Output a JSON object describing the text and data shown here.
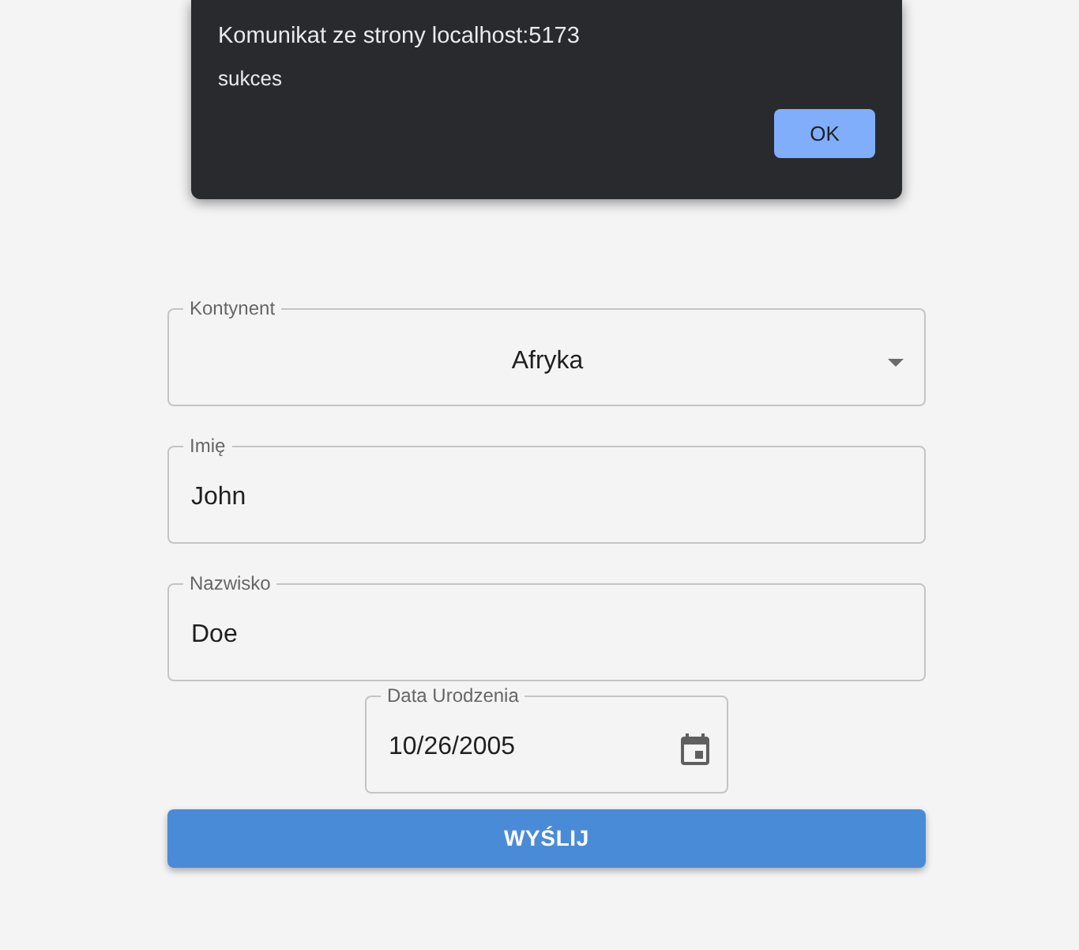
{
  "dialog": {
    "title": "Komunikat ze strony localhost:5173",
    "message": "sukces",
    "button": "OK"
  },
  "form": {
    "fields": [
      {
        "kind": "select",
        "label": "Kontynent",
        "value": "Afryka"
      },
      {
        "kind": "text",
        "label": "Imię",
        "value": "John"
      },
      {
        "kind": "text",
        "label": "Nazwisko",
        "value": "Doe"
      },
      {
        "kind": "date",
        "label": "Data Urodzenia",
        "value": "10/26/2005"
      }
    ],
    "submit": "WYŚLIJ"
  }
}
